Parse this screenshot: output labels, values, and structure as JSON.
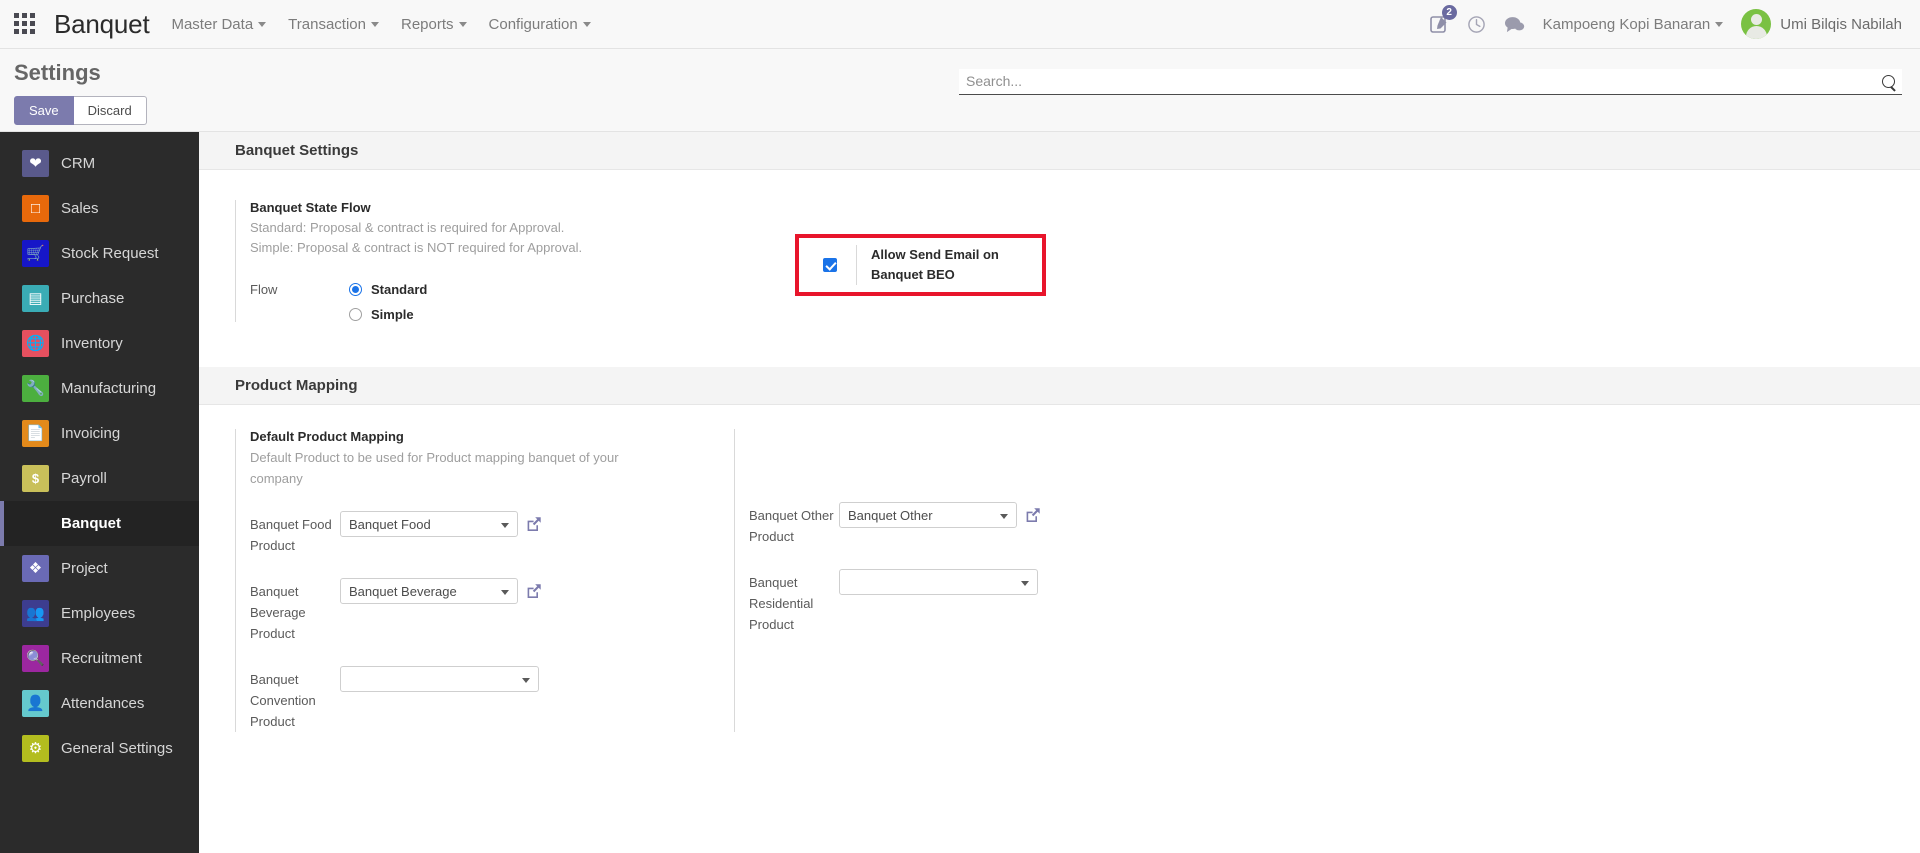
{
  "navbar": {
    "apps_icon": "apps-grid-icon",
    "brand": "Banquet",
    "menu": [
      {
        "label": "Master Data"
      },
      {
        "label": "Transaction"
      },
      {
        "label": "Reports"
      },
      {
        "label": "Configuration"
      }
    ],
    "activities_icon": "edit-note-icon",
    "activities_badge": "2",
    "clock_icon": "clock-icon",
    "messages_icon": "chat-bubble-icon",
    "company": "Kampoeng Kopi Banaran",
    "user_name": "Umi Bilqis Nabilah",
    "avatar_icon": "user-avatar"
  },
  "control_panel": {
    "title": "Settings",
    "save_label": "Save",
    "discard_label": "Discard",
    "search_placeholder": "Search...",
    "search_value": "",
    "search_icon": "search-icon"
  },
  "sidebar": {
    "items": [
      {
        "label": "CRM",
        "icon": "crm-icon",
        "color": "#5a5a8c",
        "glyph": "☚",
        "active": false
      },
      {
        "label": "Sales",
        "icon": "sales-icon",
        "color": "#e8690b",
        "glyph": "↗",
        "active": false
      },
      {
        "label": "Stock Request",
        "icon": "stock-request-icon",
        "color": "#1616c8",
        "glyph": "⛟",
        "active": false
      },
      {
        "label": "Purchase",
        "icon": "purchase-icon",
        "color": "#3aacb5",
        "glyph": "▤",
        "active": false
      },
      {
        "label": "Inventory",
        "icon": "inventory-icon",
        "color": "#e6505f",
        "glyph": "♁",
        "active": false
      },
      {
        "label": "Manufacturing",
        "icon": "manufacturing-icon",
        "color": "#4caf3f",
        "glyph": "ὒ7",
        "active": false
      },
      {
        "label": "Invoicing",
        "icon": "invoicing-icon",
        "color": "#e38a1b",
        "glyph": "὜E",
        "active": false
      },
      {
        "label": "Payroll",
        "icon": "payroll-icon",
        "color": "#c9c05a",
        "glyph": "$",
        "active": false
      },
      {
        "label": "Banquet",
        "icon": "banquet-icon",
        "color": "#2b2b2b",
        "glyph": "",
        "active": true
      },
      {
        "label": "Project",
        "icon": "project-icon",
        "color": "#6a6ab5",
        "glyph": "✦",
        "active": false
      },
      {
        "label": "Employees",
        "icon": "employees-icon",
        "color": "#3d3d8f",
        "glyph": "὆5",
        "active": false
      },
      {
        "label": "Recruitment",
        "icon": "recruitment-icon",
        "color": "#9c27a0",
        "glyph": "Ⓐ",
        "active": false
      },
      {
        "label": "Attendances",
        "icon": "attendances-icon",
        "color": "#65c9cd",
        "glyph": "☺",
        "active": false
      },
      {
        "label": "General Settings",
        "icon": "general-settings-icon",
        "color": "#b3bd1f",
        "glyph": "⚙",
        "active": false
      }
    ]
  },
  "banquet_settings": {
    "section_title": "Banquet Settings",
    "state_flow": {
      "title": "Banquet State Flow",
      "desc_line1": "Standard: Proposal & contract is required for Approval.",
      "desc_line2": "Simple: Proposal & contract is NOT required for Approval.",
      "flow_label": "Flow",
      "options": [
        {
          "label": "Standard",
          "selected": true
        },
        {
          "label": "Simple",
          "selected": false
        }
      ]
    },
    "allow_email": {
      "label": "Allow Send Email on Banquet BEO",
      "checked": true,
      "highlight_color": "#e8152b"
    }
  },
  "product_mapping": {
    "section_title": "Product Mapping",
    "block_title": "Default Product Mapping",
    "block_desc": "Default Product to be used for Product mapping banquet of your company",
    "left_fields": [
      {
        "label": "Banquet Food Product",
        "value": "Banquet Food",
        "has_link": true
      },
      {
        "label": "Banquet Beverage Product",
        "value": "Banquet Beverage",
        "has_link": true
      },
      {
        "label": "Banquet Convention Product",
        "value": "",
        "has_link": false
      }
    ],
    "right_fields": [
      {
        "label": "Banquet Other Product",
        "value": "Banquet Other",
        "has_link": true
      },
      {
        "label": "Banquet Residential Product",
        "value": "",
        "has_link": false
      }
    ],
    "external_link_icon": "external-link-icon"
  }
}
